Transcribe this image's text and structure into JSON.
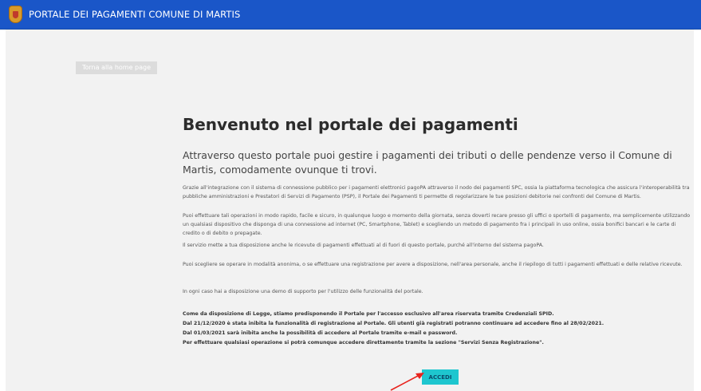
{
  "header": {
    "title": "PORTALE DEI PAGAMENTI COMUNE DI MARTIS",
    "logo": "coat-of-arms"
  },
  "nav": {
    "home_label": "Torna alla home page"
  },
  "main": {
    "heading": "Benvenuto nel portale dei pagamenti",
    "lead": "Attraverso questo portale puoi gestire i pagamenti dei tributi o delle pendenze verso il Comune di Martis, comodamente ovunque ti trovi.",
    "paragraph_1": "Grazie all'integrazione con il sistema di connessione pubblico per i pagamenti elettronici pagoPA attraverso il nodo dei pagamenti SPC, ossia la piattaforma tecnologica che assicura l'interoperabilità tra pubbliche amministrazioni e Prestatori di Servizi di Pagamento (PSP), il Portale dei Pagamenti ti permette di regolarizzare le tue posizioni debitorie nei confronti del Comune di Martis.",
    "paragraph_2": "Puoi effettuare tali operazioni in modo rapido, facile e sicuro, in qualunque luogo e momento della giornata, senza doverti recare presso gli uffici o sportelli di pagamento, ma semplicemente utilizzando un qualsiasi dispositivo che disponga di una connessione ad internet (PC, Smartphone, Tablet) e scegliendo un metodo di pagamento fra i principali in uso online, ossia bonifici bancari e le carte di credito o di debito o prepagate.",
    "paragraph_3": "Il servizio mette a tua disposizione anche le ricevute di pagamenti effettuati al di fuori di questo portale, purché all'interno del sistema pagoPA.",
    "paragraph_4": "Puoi scegliere se operare in modalità anonima, o se effettuare una registrazione per avere a disposizione, nell'area personale, anche il riepilogo di tutti i pagamenti effettuati e delle relative ricevute.",
    "paragraph_5": "In ogni caso hai a disposizione una demo di supporto per l'utilizzo delle funzionalità del portale.",
    "notice_1": "Come da disposizione di Legge, stiamo predisponendo il Portale per l'accesso esclusivo all'area riservata tramite Credenziali SPID.",
    "notice_2": "Dal 21/12/2020 è stata inibita la funzionalità di registrazione al Portale. Gli utenti già registrati potranno continuare ad accedere fino al 28/02/2021.",
    "notice_3": "Dal 01/03/2021 sarà inibita anche la possibilità di accedere al Portale tramite e-mail e password.",
    "notice_4": "Per effettuare qualsiasi operazione si potrà comunque accedere direttamente tramite la sezione \"Servizi Senza Registrazione\".",
    "login_label": "ACCEDI"
  },
  "colors": {
    "header_bg": "#1a56c8",
    "page_bg": "#f2f2f2",
    "login_button": "#1ec6cf",
    "annotation_arrow": "#e8231d"
  },
  "annotation": {
    "icon": "red-arrow"
  }
}
